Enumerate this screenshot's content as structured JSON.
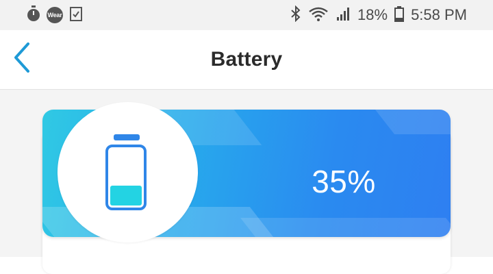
{
  "status_bar": {
    "left_icons": [
      "stopwatch-icon",
      "wear-icon",
      "checklist-icon"
    ],
    "wear_label": "Wear",
    "battery_text": "18%",
    "time": "5:58 PM",
    "right_icons": [
      "bluetooth-icon",
      "wifi-icon",
      "signal-icon",
      "battery-icon"
    ]
  },
  "header": {
    "title": "Battery",
    "back_icon": "chevron-left-icon"
  },
  "battery_card": {
    "percent_label": "35%",
    "level": 0.35,
    "icon": "battery-icon",
    "colors": {
      "gradient_start": "#30c9e4",
      "gradient_end": "#2e7ff1",
      "battery_fill": "#23d3e3",
      "battery_outline": "#2f86e8"
    }
  },
  "colors": {
    "accent": "#1e9ad6"
  }
}
